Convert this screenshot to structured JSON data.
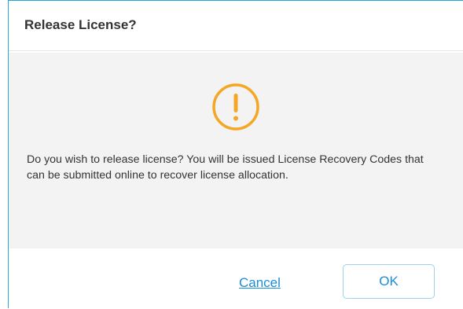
{
  "dialog": {
    "title": "Release License?",
    "icon": "exclamation-circle-icon",
    "message": "Do you wish to release license? You will be issued License Recovery Codes that can be submitted online to recover license allocation.",
    "cancel_label": "Cancel",
    "ok_label": "OK"
  },
  "colors": {
    "border_accent": "#29a3d8",
    "warning_icon": "#f5a623",
    "link": "#1a8ed6",
    "body_bg": "#f3f3f3"
  }
}
